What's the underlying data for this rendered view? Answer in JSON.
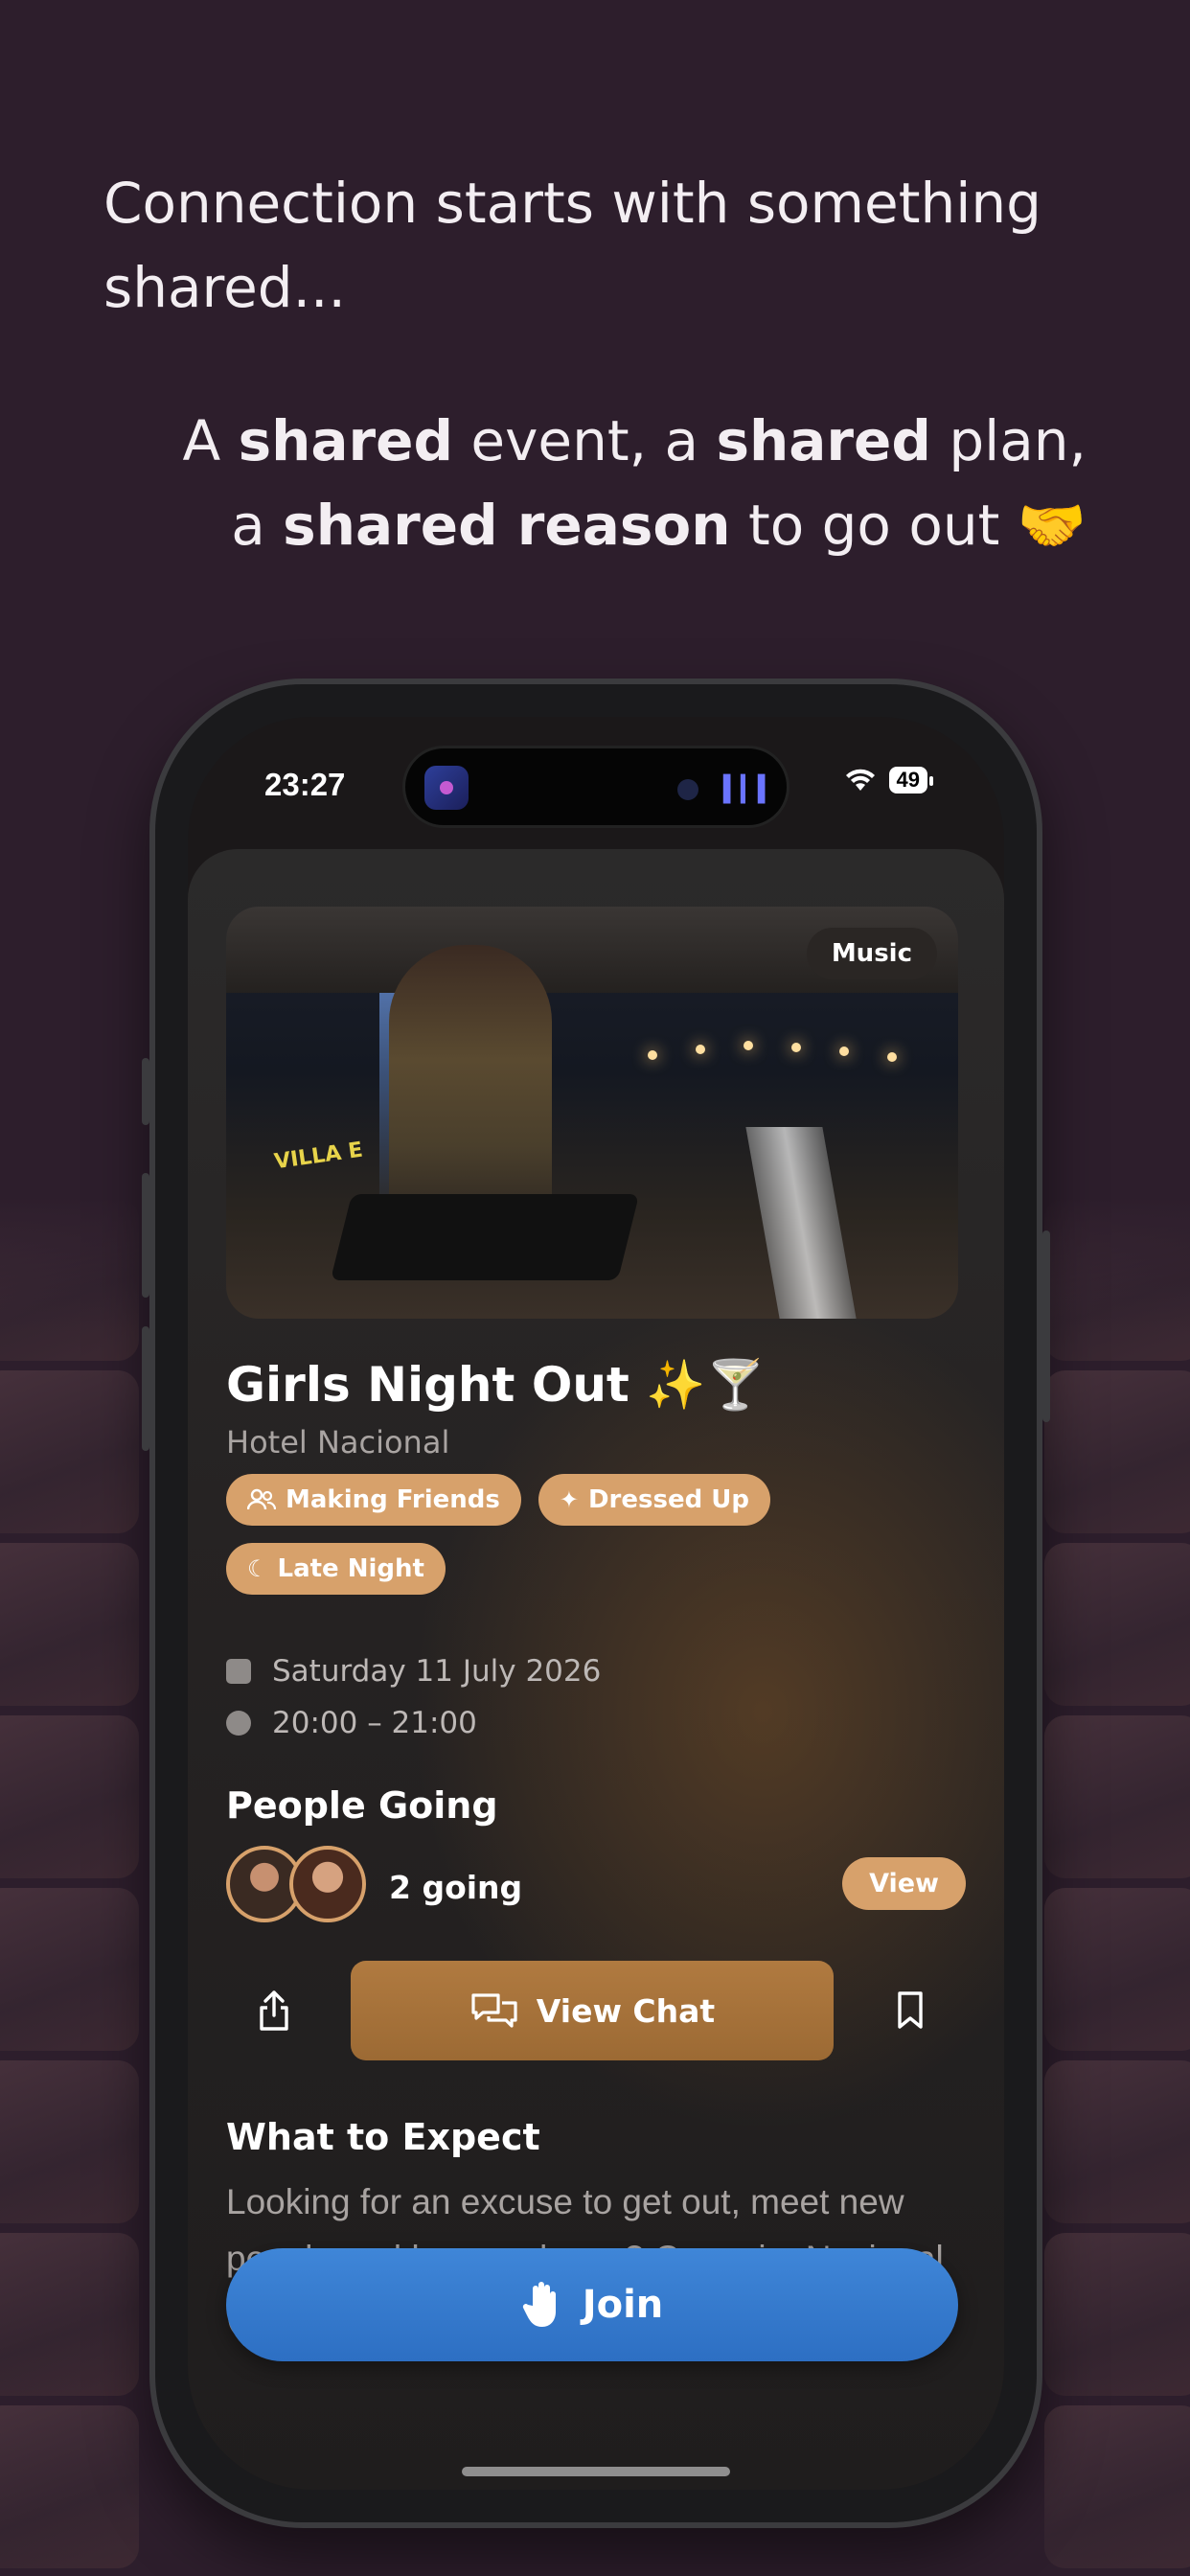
{
  "promo": {
    "headline": "Connection starts with something shared...",
    "sub_prefix_1": "A ",
    "sub_bold_1": "shared",
    "sub_mid_1": " event, a ",
    "sub_bold_2": "shared",
    "sub_mid_2": " plan,",
    "sub_prefix_2": "a ",
    "sub_bold_3": "shared reason",
    "sub_suffix": " to go out 🤝"
  },
  "status_bar": {
    "time": "23:27",
    "battery": "49"
  },
  "event": {
    "category_badge": "Music",
    "hero_sign_text": "VILLA E",
    "title": "Girls Night Out ✨🍸",
    "venue": "Hotel Nacional",
    "tags": [
      {
        "label": "Making Friends",
        "icon": "people-icon"
      },
      {
        "label": "Dressed Up",
        "icon": "sparkle-icon"
      },
      {
        "label": "Late Night",
        "icon": "moon-icon"
      }
    ],
    "date": "Saturday 11 July 2026",
    "time_range": "20:00 – 21:00"
  },
  "people": {
    "section_title": "People Going",
    "going_text": "2 going",
    "view_label": "View"
  },
  "actions": {
    "chat_label": "View Chat"
  },
  "expect": {
    "section_title": "What to Expect",
    "description": "Looking for an excuse to get out, meet new people and have a dance? Come i... Nacional (Hotel Nacional, Melbourne"
  },
  "join": {
    "label": "Join"
  },
  "colors": {
    "background": "#2d1e2c",
    "accent": "#d7a16b",
    "chat_button": "#a6713a",
    "join_button": "#3579cc"
  }
}
